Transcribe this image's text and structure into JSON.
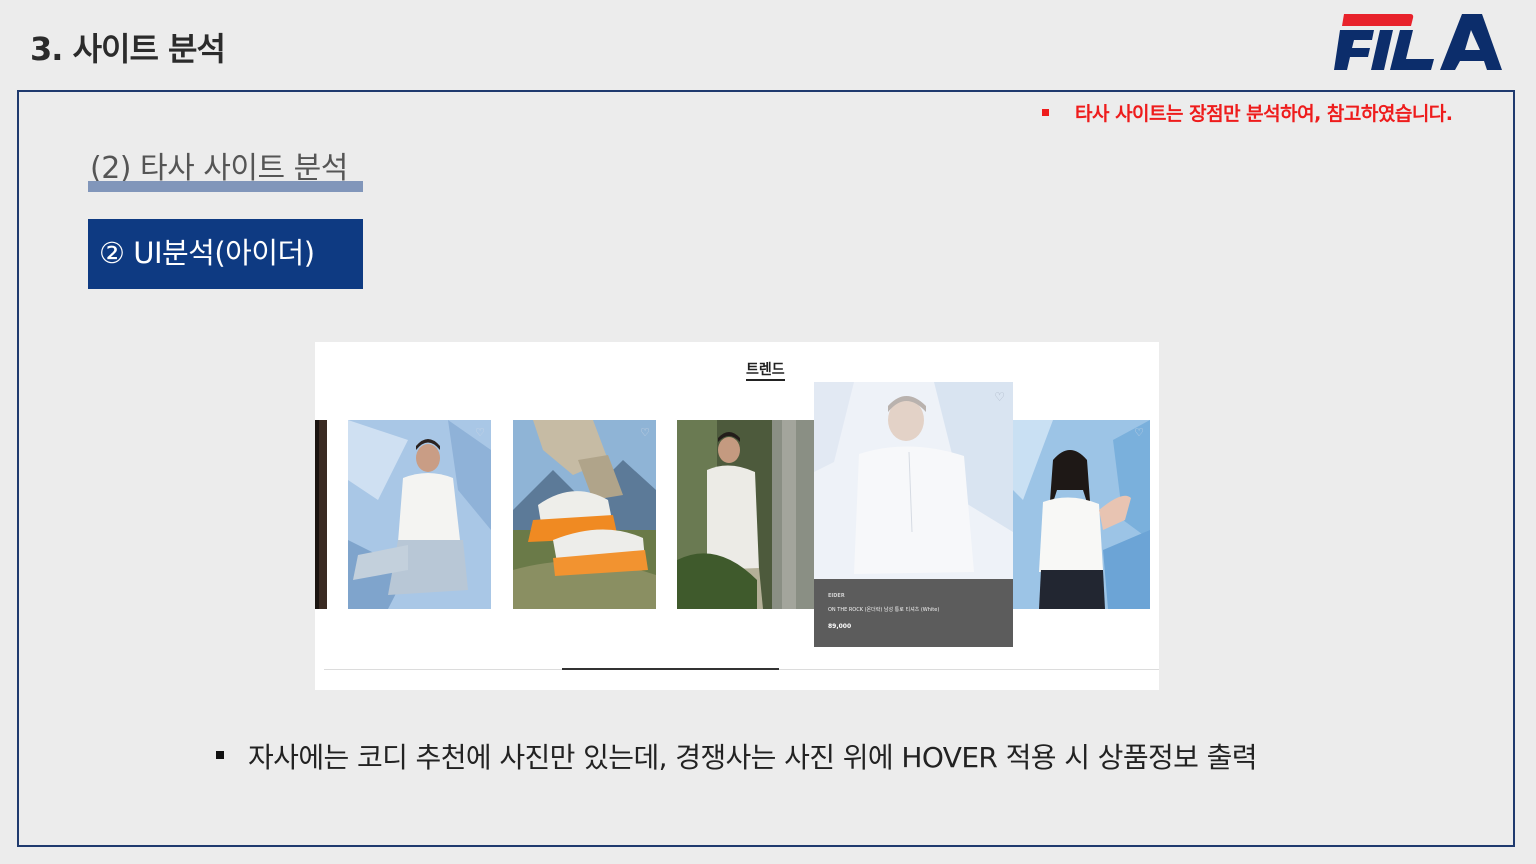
{
  "header": {
    "title": "3. 사이트 분석",
    "logo_text": "FILA",
    "logo_colors": {
      "red": "#e8222b",
      "navy": "#0c2d6b"
    }
  },
  "note": {
    "text": "타사 사이트는 장점만 분석하여, 참고하였습니다.",
    "color": "#ee1c1c"
  },
  "section": {
    "heading": "(2) 타사 사이트 분석",
    "subsection": "② UI분석(아이더)",
    "accent": "#0e3a82"
  },
  "screenshot": {
    "tab_title": "트렌드",
    "hover_product": {
      "brand": "EIDER",
      "name": "ON THE ROCK (온더락) 남성 통로 티셔츠 (White)",
      "price": "89,000"
    },
    "cards": [
      {
        "icon": "heart-icon"
      },
      {
        "icon": "heart-icon"
      },
      {
        "icon": "heart-icon"
      },
      {
        "icon": "heart-icon"
      }
    ]
  },
  "bullet": {
    "text": "자사에는 코디 추천에 사진만 있는데, 경쟁사는 사진 위에 HOVER 적용 시 상품정보 출력"
  }
}
